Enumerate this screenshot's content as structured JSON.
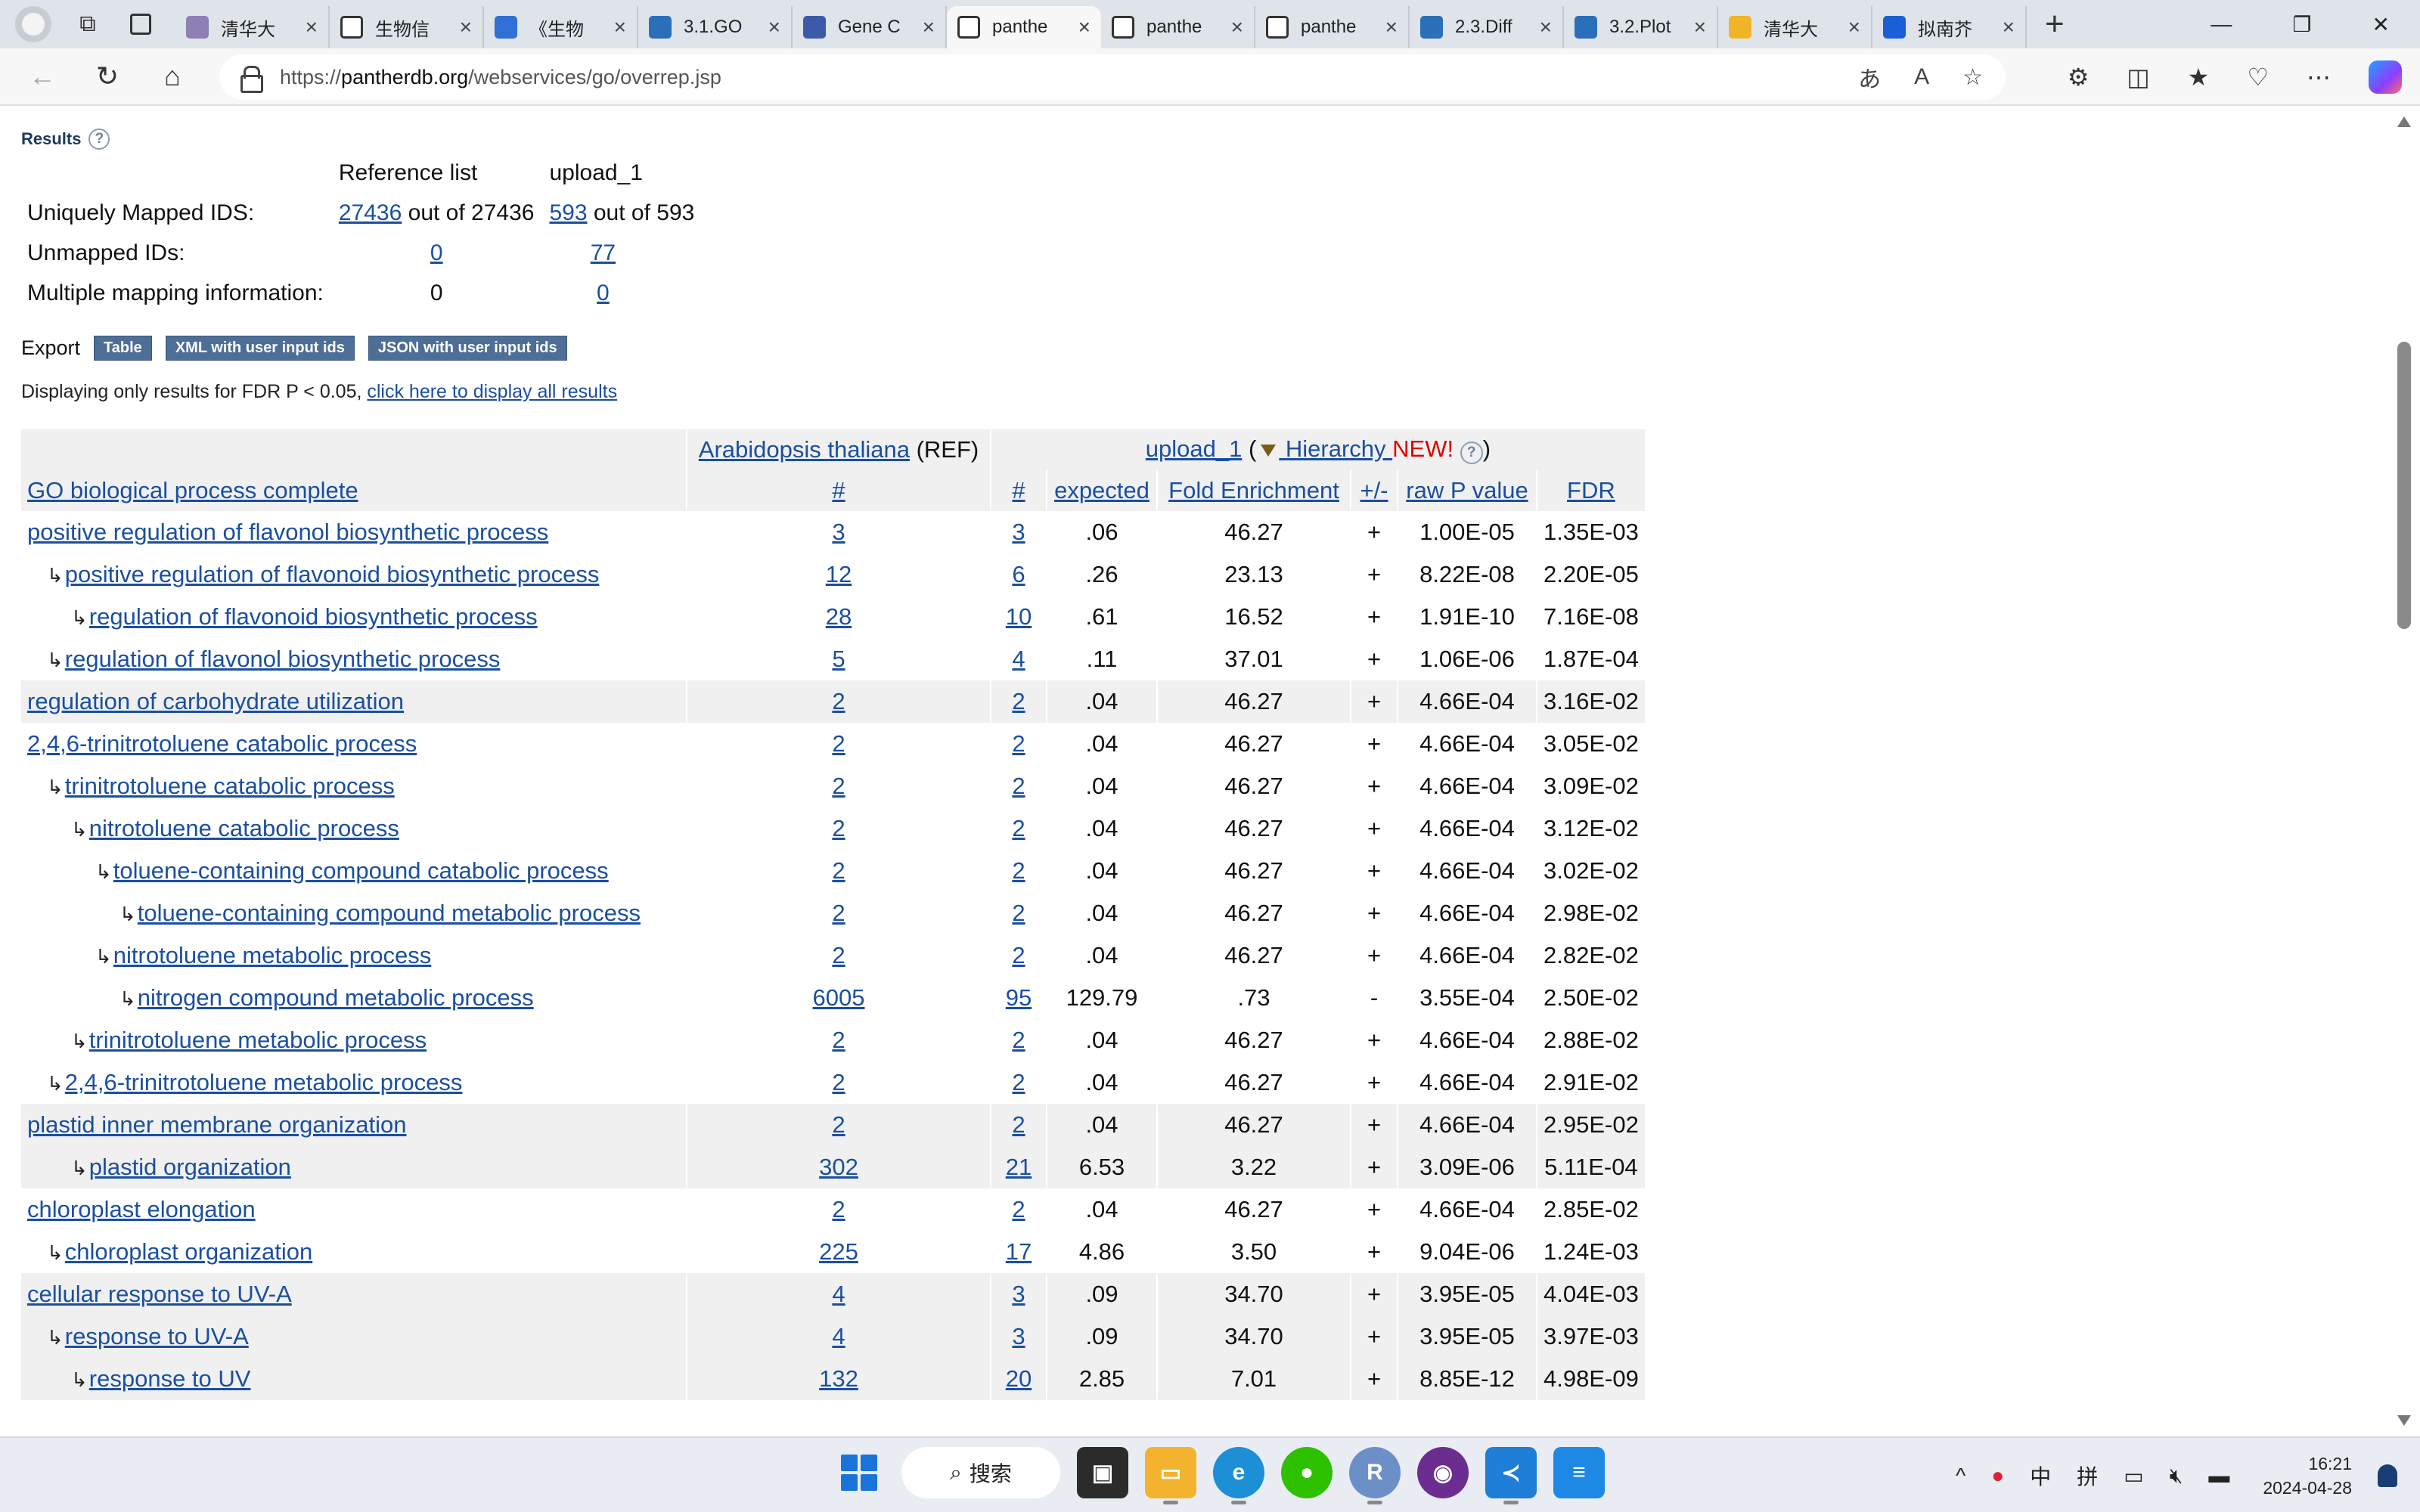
{
  "browser": {
    "tabs": [
      {
        "title": "清华大",
        "fav_color": "#8e7fb5",
        "active": false
      },
      {
        "title": "生物信",
        "fav_color": "#ffffff",
        "active": false
      },
      {
        "title": "《生物",
        "fav_color": "#2f6fd6",
        "active": false
      },
      {
        "title": "3.1.GO",
        "fav_color": "#2a6fb8",
        "active": false
      },
      {
        "title": "Gene C",
        "fav_color": "#3b5ba8",
        "active": false
      },
      {
        "title": "panthe",
        "fav_color": "#ffffff",
        "active": true
      },
      {
        "title": "panthe",
        "fav_color": "#ffffff",
        "active": false
      },
      {
        "title": "panthe",
        "fav_color": "#ffffff",
        "active": false
      },
      {
        "title": "2.3.Diff",
        "fav_color": "#2a6fb8",
        "active": false
      },
      {
        "title": "3.2.Plot",
        "fav_color": "#2a6fb8",
        "active": false
      },
      {
        "title": "清华大",
        "fav_color": "#f0b429",
        "active": false
      },
      {
        "title": "拟南芥",
        "fav_color": "#1a5fd6",
        "active": false
      }
    ],
    "url_prefix": "https://",
    "url_host": "pantherdb.org",
    "url_path": "/webservices/go/overrep.jsp",
    "new_tab_glyph": "+",
    "close_glyph": "×"
  },
  "results": {
    "title": "Results",
    "help_glyph": "?",
    "summary": {
      "col_ref": "Reference list",
      "col_upload": "upload_1",
      "rows": [
        {
          "label": "Uniquely Mapped IDS:",
          "ref_link": "27436",
          "ref_suffix": " out of 27436",
          "up_link": "593",
          "up_suffix": " out of 593"
        },
        {
          "label": "Unmapped IDs:",
          "ref_link": "0",
          "up_link": "77"
        },
        {
          "label": "Multiple mapping information:",
          "ref_text": "0",
          "up_link": "0"
        }
      ]
    },
    "export": {
      "label": "Export",
      "buttons": [
        "Table",
        "XML with user input ids",
        "JSON with user input ids"
      ]
    },
    "display_note": "Displaying only results for FDR P < 0.05, ",
    "display_link": "click here to display all results"
  },
  "table": {
    "organism_link": "Arabidopsis thaliana",
    "organism_suffix": " (REF)",
    "upload_link": "upload_1",
    "upload_open": " (",
    "hierarchy_link": " Hierarchy ",
    "new_label": "NEW!",
    "upload_close": ")",
    "columns": [
      "GO biological process complete",
      "#",
      "#",
      "expected",
      "Fold Enrichment",
      "+/-",
      "raw P value",
      "FDR"
    ],
    "arrow": "↳",
    "rows": [
      {
        "term": "positive regulation of flavonol biosynthetic process",
        "level": 0,
        "ref": "3",
        "up": "3",
        "expected": ".06",
        "fold": "46.27",
        "sign": "+",
        "p": "1.00E-05",
        "fdr": "1.35E-03",
        "grp": false
      },
      {
        "term": "positive regulation of flavonoid biosynthetic process",
        "level": 1,
        "ref": "12",
        "up": "6",
        "expected": ".26",
        "fold": "23.13",
        "sign": "+",
        "p": "8.22E-08",
        "fdr": "2.20E-05",
        "grp": false
      },
      {
        "term": "regulation of flavonoid biosynthetic process",
        "level": 2,
        "ref": "28",
        "up": "10",
        "expected": ".61",
        "fold": "16.52",
        "sign": "+",
        "p": "1.91E-10",
        "fdr": "7.16E-08",
        "grp": false
      },
      {
        "term": "regulation of flavonol biosynthetic process",
        "level": 1,
        "ref": "5",
        "up": "4",
        "expected": ".11",
        "fold": "37.01",
        "sign": "+",
        "p": "1.06E-06",
        "fdr": "1.87E-04",
        "grp": false
      },
      {
        "term": "regulation of carbohydrate utilization",
        "level": 0,
        "ref": "2",
        "up": "2",
        "expected": ".04",
        "fold": "46.27",
        "sign": "+",
        "p": "4.66E-04",
        "fdr": "3.16E-02",
        "grp": true
      },
      {
        "term": "2,4,6-trinitrotoluene catabolic process",
        "level": 0,
        "ref": "2",
        "up": "2",
        "expected": ".04",
        "fold": "46.27",
        "sign": "+",
        "p": "4.66E-04",
        "fdr": "3.05E-02",
        "grp": false
      },
      {
        "term": "trinitrotoluene catabolic process",
        "level": 1,
        "ref": "2",
        "up": "2",
        "expected": ".04",
        "fold": "46.27",
        "sign": "+",
        "p": "4.66E-04",
        "fdr": "3.09E-02",
        "grp": false
      },
      {
        "term": "nitrotoluene catabolic process",
        "level": 2,
        "ref": "2",
        "up": "2",
        "expected": ".04",
        "fold": "46.27",
        "sign": "+",
        "p": "4.66E-04",
        "fdr": "3.12E-02",
        "grp": false
      },
      {
        "term": "toluene-containing compound catabolic process",
        "level": 3,
        "ref": "2",
        "up": "2",
        "expected": ".04",
        "fold": "46.27",
        "sign": "+",
        "p": "4.66E-04",
        "fdr": "3.02E-02",
        "grp": false
      },
      {
        "term": "toluene-containing compound metabolic process",
        "level": 4,
        "ref": "2",
        "up": "2",
        "expected": ".04",
        "fold": "46.27",
        "sign": "+",
        "p": "4.66E-04",
        "fdr": "2.98E-02",
        "grp": false
      },
      {
        "term": "nitrotoluene metabolic process",
        "level": 3,
        "ref": "2",
        "up": "2",
        "expected": ".04",
        "fold": "46.27",
        "sign": "+",
        "p": "4.66E-04",
        "fdr": "2.82E-02",
        "grp": false
      },
      {
        "term": "nitrogen compound metabolic process",
        "level": 4,
        "ref": "6005",
        "up": "95",
        "expected": "129.79",
        "fold": ".73",
        "sign": "-",
        "p": "3.55E-04",
        "fdr": "2.50E-02",
        "grp": false
      },
      {
        "term": "trinitrotoluene metabolic process",
        "level": 2,
        "ref": "2",
        "up": "2",
        "expected": ".04",
        "fold": "46.27",
        "sign": "+",
        "p": "4.66E-04",
        "fdr": "2.88E-02",
        "grp": false
      },
      {
        "term": "2,4,6-trinitrotoluene metabolic process",
        "level": 1,
        "ref": "2",
        "up": "2",
        "expected": ".04",
        "fold": "46.27",
        "sign": "+",
        "p": "4.66E-04",
        "fdr": "2.91E-02",
        "grp": false
      },
      {
        "term": "plastid inner membrane organization",
        "level": 0,
        "ref": "2",
        "up": "2",
        "expected": ".04",
        "fold": "46.27",
        "sign": "+",
        "p": "4.66E-04",
        "fdr": "2.95E-02",
        "grp": true
      },
      {
        "term": "plastid organization",
        "level": 2,
        "ref": "302",
        "up": "21",
        "expected": "6.53",
        "fold": "3.22",
        "sign": "+",
        "p": "3.09E-06",
        "fdr": "5.11E-04",
        "grp": true
      },
      {
        "term": "chloroplast elongation",
        "level": 0,
        "ref": "2",
        "up": "2",
        "expected": ".04",
        "fold": "46.27",
        "sign": "+",
        "p": "4.66E-04",
        "fdr": "2.85E-02",
        "grp": false
      },
      {
        "term": "chloroplast organization",
        "level": 1,
        "ref": "225",
        "up": "17",
        "expected": "4.86",
        "fold": "3.50",
        "sign": "+",
        "p": "9.04E-06",
        "fdr": "1.24E-03",
        "grp": false
      },
      {
        "term": "cellular response to UV-A",
        "level": 0,
        "ref": "4",
        "up": "3",
        "expected": ".09",
        "fold": "34.70",
        "sign": "+",
        "p": "3.95E-05",
        "fdr": "4.04E-03",
        "grp": true
      },
      {
        "term": "response to UV-A",
        "level": 1,
        "ref": "4",
        "up": "3",
        "expected": ".09",
        "fold": "34.70",
        "sign": "+",
        "p": "3.95E-05",
        "fdr": "3.97E-03",
        "grp": true
      },
      {
        "term": "response to UV",
        "level": 2,
        "ref": "132",
        "up": "20",
        "expected": "2.85",
        "fold": "7.01",
        "sign": "+",
        "p": "8.85E-12",
        "fdr": "4.98E-09",
        "grp": true
      }
    ]
  },
  "taskbar": {
    "search_label": "搜索",
    "tray_ime_1": "中",
    "tray_ime_2": "拼",
    "time": "16:21",
    "date": "2024-04-28"
  }
}
